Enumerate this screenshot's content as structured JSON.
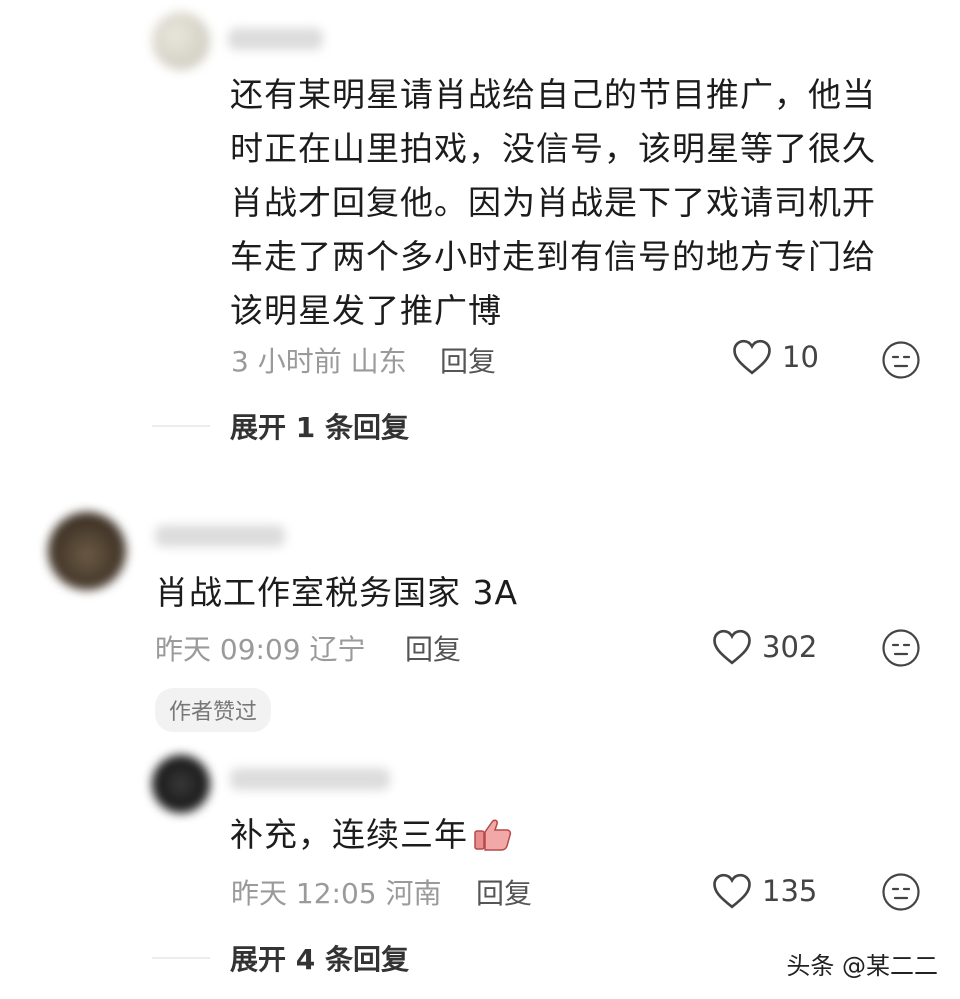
{
  "comments": [
    {
      "text": "还有某明星请肖战给自己的节目推广，他当时正在山里拍戏，没信号，该明星等了很久肖战才回复他。因为肖战是下了戏请司机开车走了两个多小时走到有信号的地方专门给该明星发了推广博",
      "meta": "3 小时前 山东",
      "reply_label": "回复",
      "likes": "10",
      "expand_label": "展开 1 条回复"
    },
    {
      "text": "肖战工作室税务国家 3A",
      "meta": "昨天 09:09 辽宁",
      "reply_label": "回复",
      "likes": "302",
      "badge": "作者赞过"
    },
    {
      "text": "补充，连续三年",
      "meta": "昨天 12:05 河南",
      "reply_label": "回复",
      "likes": "135",
      "expand_label": "展开 4 条回复"
    }
  ],
  "watermark": "头条 @某二二"
}
